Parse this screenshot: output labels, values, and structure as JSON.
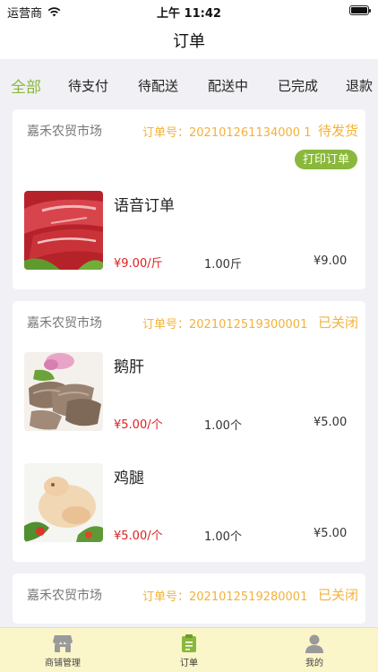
{
  "status_bar": {
    "carrier": "运营商",
    "time": "上午 11:42"
  },
  "nav": {
    "title": "订单"
  },
  "tabs": [
    {
      "label": "全部",
      "active": true
    },
    {
      "label": "待支付"
    },
    {
      "label": "待配送"
    },
    {
      "label": "配送中"
    },
    {
      "label": "已完成"
    },
    {
      "label": "退款"
    }
  ],
  "orders": [
    {
      "market": "嘉禾农贸市场",
      "order_no": "订单号：202101261134000 1",
      "status": "待发货",
      "print_label": "打印订单",
      "items": [
        {
          "name": "语音订单",
          "price": "¥9.00/斤",
          "qty": "1.00斤",
          "total": "¥9.00",
          "image": "beef"
        }
      ]
    },
    {
      "market": "嘉禾农贸市场",
      "order_no": "订单号：2021012519300001",
      "status": "已关闭",
      "items": [
        {
          "name": "鹅肝",
          "price": "¥5.00/个",
          "qty": "1.00个",
          "total": "¥5.00",
          "image": "goose-liver"
        },
        {
          "name": "鸡腿",
          "price": "¥5.00/个",
          "qty": "1.00个",
          "total": "¥5.00",
          "image": "chicken"
        }
      ]
    },
    {
      "market": "嘉禾农贸市场",
      "order_no": "订单号：2021012519280001",
      "status": "已关闭",
      "items": []
    }
  ],
  "bottom_nav": [
    {
      "label": "商铺管理",
      "icon": "shop-icon"
    },
    {
      "label": "订单",
      "icon": "order-clipboard-icon",
      "active": true
    },
    {
      "label": "我的",
      "icon": "person-icon"
    }
  ],
  "colors": {
    "accent_green": "#8ab83c",
    "status_orange": "#f3b23a",
    "price_red": "#e02020",
    "bottom_bar_bg": "#fbf6c9"
  }
}
